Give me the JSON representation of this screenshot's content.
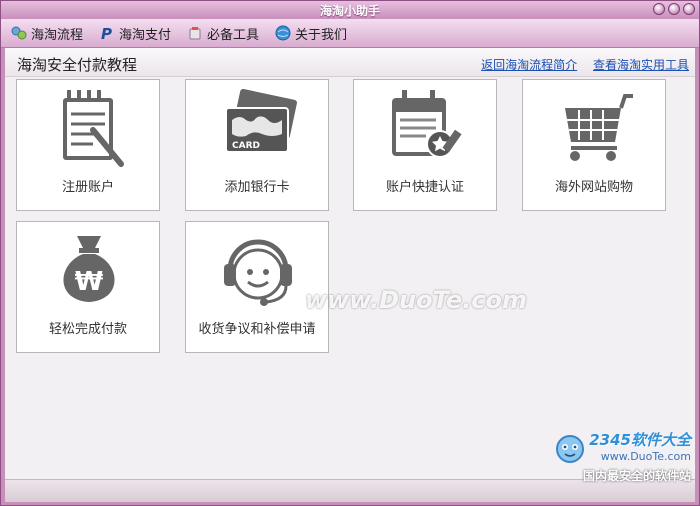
{
  "window": {
    "title": "海淘小助手"
  },
  "menu": {
    "items": [
      "海淘流程",
      "海淘支付",
      "必备工具",
      "关于我们"
    ]
  },
  "header": {
    "title": "海淘安全付款教程",
    "link_back": "返回海淘流程简介",
    "link_tools": "查看海淘实用工具"
  },
  "tiles": [
    {
      "label": "注册账户",
      "icon": "notebook-pen-icon"
    },
    {
      "label": "添加银行卡",
      "icon": "bank-card-icon",
      "card_text": "CARD"
    },
    {
      "label": "账户快捷认证",
      "icon": "certificate-seal-icon"
    },
    {
      "label": "海外网站购物",
      "icon": "shopping-cart-icon"
    },
    {
      "label": "轻松完成付款",
      "icon": "money-bag-icon",
      "symbol": "₩"
    },
    {
      "label": "收货争议和补偿申请",
      "icon": "headset-support-icon"
    }
  ],
  "watermark": "www.DuoTe.com",
  "brand": {
    "name": "2345软件大全",
    "url": "www.DuoTe.com",
    "slogan": "国内最安全的软件站"
  },
  "colors": {
    "frame": "#c98fbb",
    "link": "#1a4fb5",
    "icon": "#666666"
  }
}
